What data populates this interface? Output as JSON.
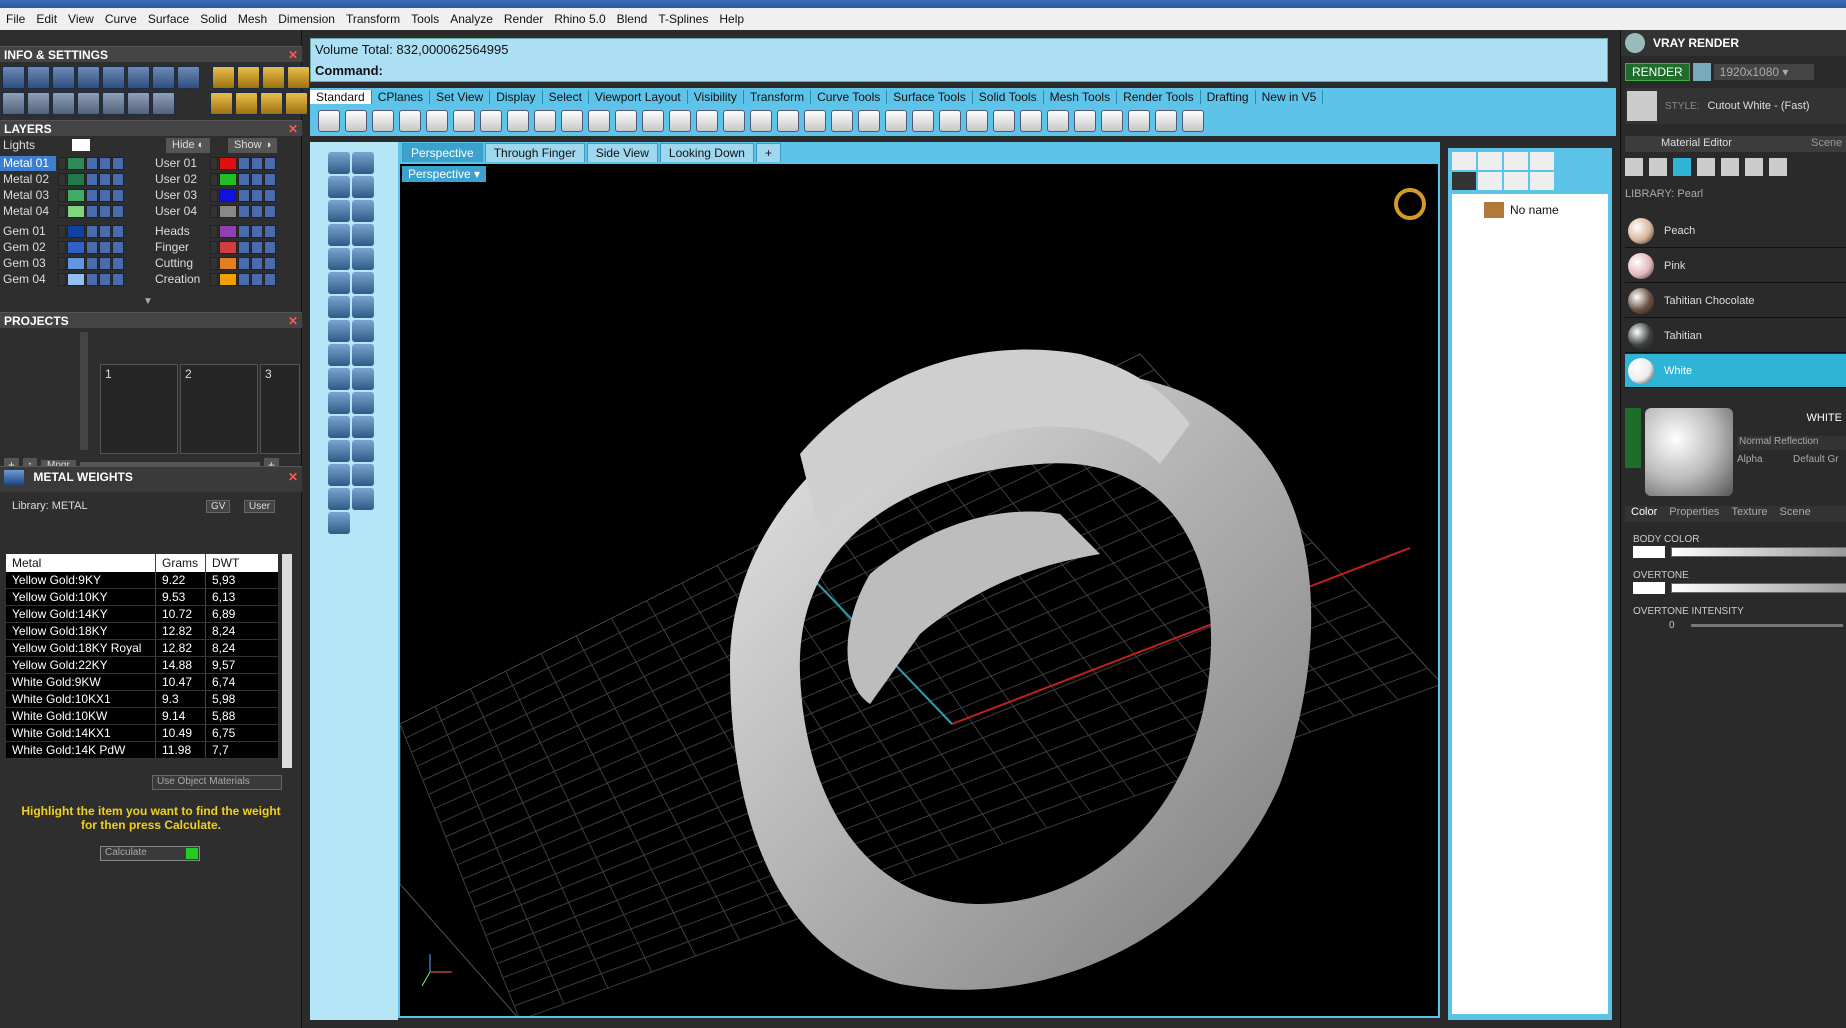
{
  "menu": [
    "File",
    "Edit",
    "View",
    "Curve",
    "Surface",
    "Solid",
    "Mesh",
    "Dimension",
    "Transform",
    "Tools",
    "Analyze",
    "Render",
    "Rhino 5.0",
    "Blend",
    "T-Splines",
    "Help"
  ],
  "left": {
    "info_title": "INFO & SETTINGS",
    "layers_title": "LAYERS",
    "lights_label": "Lights",
    "hide_label": "Hide",
    "show_label": "Show",
    "layers_left": [
      {
        "name": "Metal 01",
        "color": "#2e8b57"
      },
      {
        "name": "Metal 02",
        "color": "#1e7a46"
      },
      {
        "name": "Metal 03",
        "color": "#3fae62"
      },
      {
        "name": "Metal 04",
        "color": "#7fd67f"
      },
      {
        "name": "Gem 01",
        "color": "#1040a0"
      },
      {
        "name": "Gem 02",
        "color": "#3060c8"
      },
      {
        "name": "Gem 03",
        "color": "#6098e0"
      },
      {
        "name": "Gem 04",
        "color": "#90c0f0"
      }
    ],
    "layers_right": [
      {
        "name": "User 01",
        "color": "#e01010"
      },
      {
        "name": "User 02",
        "color": "#20c020"
      },
      {
        "name": "User 03",
        "color": "#1010e0"
      },
      {
        "name": "User 04",
        "color": "#888888"
      },
      {
        "name": "Heads",
        "color": "#9040b0"
      },
      {
        "name": "Finger",
        "color": "#d04040"
      },
      {
        "name": "Cutting",
        "color": "#e08020"
      },
      {
        "name": "Creation",
        "color": "#f0a000"
      }
    ],
    "projects_title": "PROJECTS",
    "projects": [
      "1",
      "2",
      "3"
    ],
    "mngr_label": "Mngr",
    "metal_title": "METAL WEIGHTS",
    "library_label": "Library: METAL",
    "gv_label": "GV",
    "user_label": "User",
    "table_headers": [
      "Metal",
      "Grams",
      "DWT"
    ],
    "metals": [
      [
        "Yellow Gold:9KY",
        "9.22",
        "5,93"
      ],
      [
        "Yellow Gold:10KY",
        "9.53",
        "6,13"
      ],
      [
        "Yellow Gold:14KY",
        "10.72",
        "6,89"
      ],
      [
        "Yellow Gold:18KY",
        "12.82",
        "8,24"
      ],
      [
        "Yellow Gold:18KY Royal",
        "12.82",
        "8,24"
      ],
      [
        "Yellow Gold:22KY",
        "14.88",
        "9,57"
      ],
      [
        "White Gold:9KW",
        "10.47",
        "6,74"
      ],
      [
        "White Gold:10KX1",
        "9.3",
        "5,98"
      ],
      [
        "White Gold:10KW",
        "9.14",
        "5,88"
      ],
      [
        "White Gold:14KX1",
        "10.49",
        "6,75"
      ],
      [
        "White Gold:14K PdW",
        "11.98",
        "7,7"
      ]
    ],
    "use_object_materials": "Use Object Materials",
    "hint": "Highlight the item you want to find the weight for then press Calculate.",
    "calculate": "Calculate"
  },
  "command": {
    "volume": "Volume Total: 832,000062564995",
    "prompt": "Command:"
  },
  "tabs": [
    "Standard",
    "CPlanes",
    "Set View",
    "Display",
    "Select",
    "Viewport Layout",
    "Visibility",
    "Transform",
    "Curve Tools",
    "Surface Tools",
    "Solid Tools",
    "Mesh Tools",
    "Render Tools",
    "Drafting",
    "New in V5"
  ],
  "viewport_tabs": [
    "Perspective",
    "Through Finger",
    "Side View",
    "Looking Down"
  ],
  "viewport_label": "Perspective",
  "tree_item": "No name",
  "right": {
    "title": "VRAY RENDER",
    "render": "RENDER",
    "resolution": "1920x1080",
    "style_prefix": "STYLE:",
    "style": "Cutout White - (Fast)",
    "editor": "Material Editor",
    "scene": "Scene",
    "library": "LIBRARY: Pearl",
    "materials": [
      {
        "name": "Peach",
        "color": "#d9b49a"
      },
      {
        "name": "Pink",
        "color": "#e3b7b7"
      },
      {
        "name": "Tahitian Chocolate",
        "color": "#6a4f42"
      },
      {
        "name": "Tahitian",
        "color": "#3a4040"
      },
      {
        "name": "White",
        "color": "#ececec"
      }
    ],
    "selected_name": "WHITE",
    "normal_reflection": "Normal Reflection",
    "alpha": "Alpha",
    "default": "Default Gr",
    "subtabs": [
      "Color",
      "Properties",
      "Texture",
      "Scene"
    ],
    "body_color": "BODY COLOR",
    "overtone": "OVERTONE",
    "overtone_intensity": "OVERTONE INTENSITY",
    "intensity_value": "0"
  }
}
